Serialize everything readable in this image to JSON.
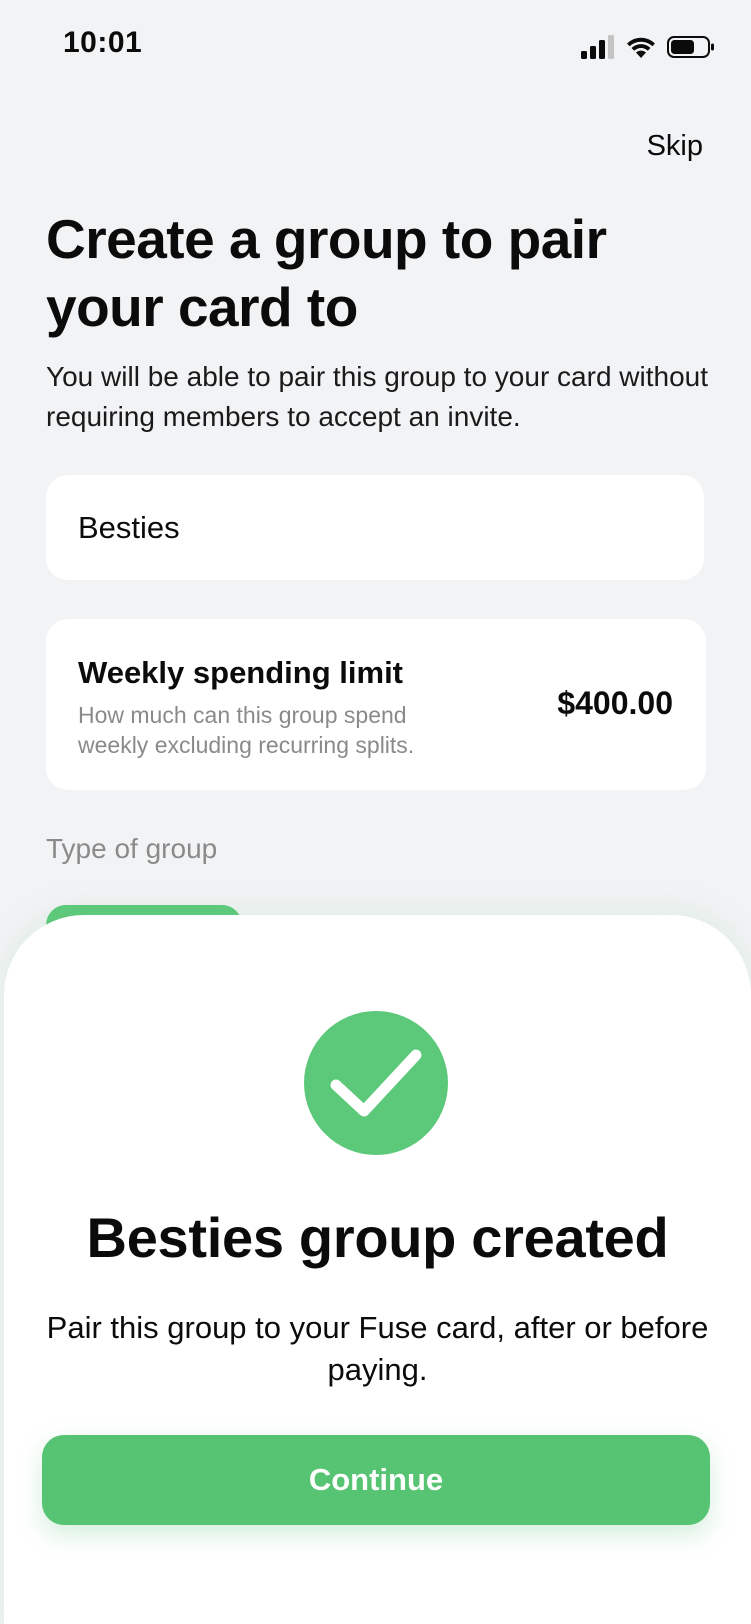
{
  "status_bar": {
    "time": "10:01",
    "icons": [
      "signal-icon",
      "wifi-icon",
      "battery-icon"
    ]
  },
  "header": {
    "skip_label": "Skip"
  },
  "main": {
    "title": "Create a group to pair your card to",
    "subtitle": "You will be able to pair this group to your card without requiring members to accept an invite.",
    "group_name_value": "Besties",
    "spending_limit": {
      "title": "Weekly spending limit",
      "description": "How much can this group spend weekly excluding recurring splits.",
      "value": "$400.00"
    },
    "group_type_label": "Type of group"
  },
  "modal": {
    "icon": "checkmark-icon",
    "title": "Besties group created",
    "message": "Pair this group to your Fuse card, after or before paying.",
    "continue_label": "Continue"
  },
  "colors": {
    "accent": "#56c472",
    "background": "#f2f3f5",
    "card": "#ffffff",
    "muted_text": "#8a8a8a"
  }
}
